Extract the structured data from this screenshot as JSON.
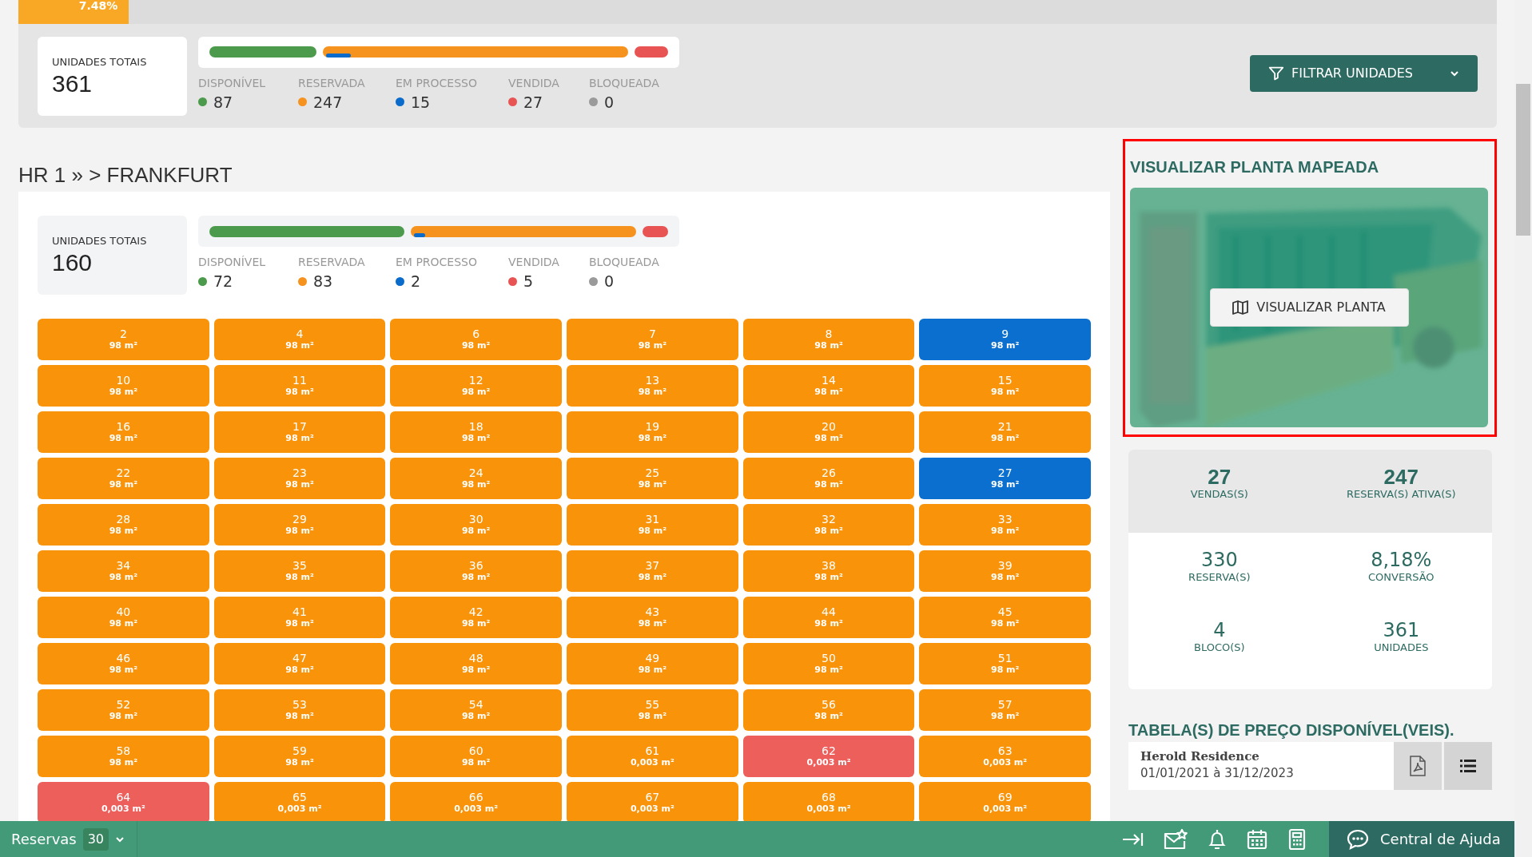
{
  "progress": {
    "label": "7.48%",
    "level": 0.0748
  },
  "overview": {
    "total_label": "UNIDADES TOTAIS",
    "total": "361",
    "stats": [
      {
        "kind": "available",
        "label": "DISPONÍVEL",
        "value": "87",
        "color": "#4c9a4c"
      },
      {
        "kind": "reserved",
        "label": "RESERVADA",
        "value": "247",
        "color": "#f6921e"
      },
      {
        "kind": "processing",
        "label": "EM PROCESSO",
        "value": "15",
        "color": "#0a6bcb"
      },
      {
        "kind": "sold",
        "label": "VENDIDA",
        "value": "27",
        "color": "#e85454"
      },
      {
        "kind": "blocked",
        "label": "BLOQUEADA",
        "value": "0",
        "color": "#9a9a9a"
      }
    ]
  },
  "filter_button": "FILTRAR UNIDADES",
  "breadcrumb": "HR 1 » > FRANKFURT",
  "block": {
    "total_label": "UNIDADES TOTAIS",
    "total": "160",
    "stats": [
      {
        "kind": "available",
        "label": "DISPONÍVEL",
        "value": "72",
        "color": "#4c9a4c"
      },
      {
        "kind": "reserved",
        "label": "RESERVADA",
        "value": "83",
        "color": "#f6921e"
      },
      {
        "kind": "processing",
        "label": "EM PROCESSO",
        "value": "2",
        "color": "#0a6bcb"
      },
      {
        "kind": "sold",
        "label": "VENDIDA",
        "value": "5",
        "color": "#e85454"
      },
      {
        "kind": "blocked",
        "label": "BLOQUEADA",
        "value": "0",
        "color": "#9a9a9a"
      }
    ],
    "units": [
      {
        "number": "2",
        "area": "98 m²",
        "color": "#f8930a"
      },
      {
        "number": "4",
        "area": "98 m²",
        "color": "#f8930a"
      },
      {
        "number": "6",
        "area": "98 m²",
        "color": "#f8930a"
      },
      {
        "number": "7",
        "area": "98 m²",
        "color": "#f8930a"
      },
      {
        "number": "8",
        "area": "98 m²",
        "color": "#f8930a"
      },
      {
        "number": "9",
        "area": "98 m²",
        "color": "#0a6fcf"
      },
      {
        "number": "10",
        "area": "98 m²",
        "color": "#f8930a"
      },
      {
        "number": "11",
        "area": "98 m²",
        "color": "#f8930a"
      },
      {
        "number": "12",
        "area": "98 m²",
        "color": "#f8930a"
      },
      {
        "number": "13",
        "area": "98 m²",
        "color": "#f8930a"
      },
      {
        "number": "14",
        "area": "98 m²",
        "color": "#f8930a"
      },
      {
        "number": "15",
        "area": "98 m²",
        "color": "#f8930a"
      },
      {
        "number": "16",
        "area": "98 m²",
        "color": "#f8930a"
      },
      {
        "number": "17",
        "area": "98 m²",
        "color": "#f8930a"
      },
      {
        "number": "18",
        "area": "98 m²",
        "color": "#f8930a"
      },
      {
        "number": "19",
        "area": "98 m²",
        "color": "#f8930a"
      },
      {
        "number": "20",
        "area": "98 m²",
        "color": "#f8930a"
      },
      {
        "number": "21",
        "area": "98 m²",
        "color": "#f8930a"
      },
      {
        "number": "22",
        "area": "98 m²",
        "color": "#f8930a"
      },
      {
        "number": "23",
        "area": "98 m²",
        "color": "#f8930a"
      },
      {
        "number": "24",
        "area": "98 m²",
        "color": "#f8930a"
      },
      {
        "number": "25",
        "area": "98 m²",
        "color": "#f8930a"
      },
      {
        "number": "26",
        "area": "98 m²",
        "color": "#f8930a"
      },
      {
        "number": "27",
        "area": "98 m²",
        "color": "#0a6fcf"
      },
      {
        "number": "28",
        "area": "98 m²",
        "color": "#f8930a"
      },
      {
        "number": "29",
        "area": "98 m²",
        "color": "#f8930a"
      },
      {
        "number": "30",
        "area": "98 m²",
        "color": "#f8930a"
      },
      {
        "number": "31",
        "area": "98 m²",
        "color": "#f8930a"
      },
      {
        "number": "32",
        "area": "98 m²",
        "color": "#f8930a"
      },
      {
        "number": "33",
        "area": "98 m²",
        "color": "#f8930a"
      },
      {
        "number": "34",
        "area": "98 m²",
        "color": "#f8930a"
      },
      {
        "number": "35",
        "area": "98 m²",
        "color": "#f8930a"
      },
      {
        "number": "36",
        "area": "98 m²",
        "color": "#f8930a"
      },
      {
        "number": "37",
        "area": "98 m²",
        "color": "#f8930a"
      },
      {
        "number": "38",
        "area": "98 m²",
        "color": "#f8930a"
      },
      {
        "number": "39",
        "area": "98 m²",
        "color": "#f8930a"
      },
      {
        "number": "40",
        "area": "98 m²",
        "color": "#f8930a"
      },
      {
        "number": "41",
        "area": "98 m²",
        "color": "#f8930a"
      },
      {
        "number": "42",
        "area": "98 m²",
        "color": "#f8930a"
      },
      {
        "number": "43",
        "area": "98 m²",
        "color": "#f8930a"
      },
      {
        "number": "44",
        "area": "98 m²",
        "color": "#f8930a"
      },
      {
        "number": "45",
        "area": "98 m²",
        "color": "#f8930a"
      },
      {
        "number": "46",
        "area": "98 m²",
        "color": "#f8930a"
      },
      {
        "number": "47",
        "area": "98 m²",
        "color": "#f8930a"
      },
      {
        "number": "48",
        "area": "98 m²",
        "color": "#f8930a"
      },
      {
        "number": "49",
        "area": "98 m²",
        "color": "#f8930a"
      },
      {
        "number": "50",
        "area": "98 m²",
        "color": "#f8930a"
      },
      {
        "number": "51",
        "area": "98 m²",
        "color": "#f8930a"
      },
      {
        "number": "52",
        "area": "98 m²",
        "color": "#f8930a"
      },
      {
        "number": "53",
        "area": "98 m²",
        "color": "#f8930a"
      },
      {
        "number": "54",
        "area": "98 m²",
        "color": "#f8930a"
      },
      {
        "number": "55",
        "area": "98 m²",
        "color": "#f8930a"
      },
      {
        "number": "56",
        "area": "98 m²",
        "color": "#f8930a"
      },
      {
        "number": "57",
        "area": "98 m²",
        "color": "#f8930a"
      },
      {
        "number": "58",
        "area": "98 m²",
        "color": "#f8930a"
      },
      {
        "number": "59",
        "area": "98 m²",
        "color": "#f8930a"
      },
      {
        "number": "60",
        "area": "98 m²",
        "color": "#f8930a"
      },
      {
        "number": "61",
        "area": "0,003 m²",
        "color": "#f8930a"
      },
      {
        "number": "62",
        "area": "0,003 m²",
        "color": "#ec5f5b"
      },
      {
        "number": "63",
        "area": "0,003 m²",
        "color": "#f8930a"
      },
      {
        "number": "64",
        "area": "0,003 m²",
        "color": "#ec5f5b"
      },
      {
        "number": "65",
        "area": "0,003 m²",
        "color": "#f8930a"
      },
      {
        "number": "66",
        "area": "0,003 m²",
        "color": "#f8930a"
      },
      {
        "number": "67",
        "area": "0,003 m²",
        "color": "#f8930a"
      },
      {
        "number": "68",
        "area": "0,003 m²",
        "color": "#f8930a"
      },
      {
        "number": "69",
        "area": "0,003 m²",
        "color": "#f8930a"
      }
    ]
  },
  "map_panel": {
    "title": "VISUALIZAR PLANTA MAPEADA",
    "button": "VISUALIZAR PLANTA"
  },
  "summary": [
    {
      "kind": "highlight",
      "value": "27",
      "label": "VENDAS(S)"
    },
    {
      "kind": "highlight",
      "value": "247",
      "label": "RESERVA(S) ATIVA(S)"
    },
    {
      "kind": "plain",
      "value": "330",
      "label": "RESERVA(S)"
    },
    {
      "kind": "plain",
      "value": "8,18%",
      "label": "CONVERSÃO"
    },
    {
      "kind": "plain",
      "value": "4",
      "label": "BLOCO(S)"
    },
    {
      "kind": "plain",
      "value": "361",
      "label": "UNIDADES"
    }
  ],
  "price_tables": {
    "title": "TABELA(S) DE PREÇO DISPONÍVEL(VEIS).",
    "items": [
      {
        "name": "Herold Residence",
        "period": "01/01/2021 à 31/12/2023"
      }
    ]
  },
  "bottom_bar": {
    "reservas_label": "Reservas",
    "reservas_count": "30",
    "help": "Central de Ajuda"
  }
}
